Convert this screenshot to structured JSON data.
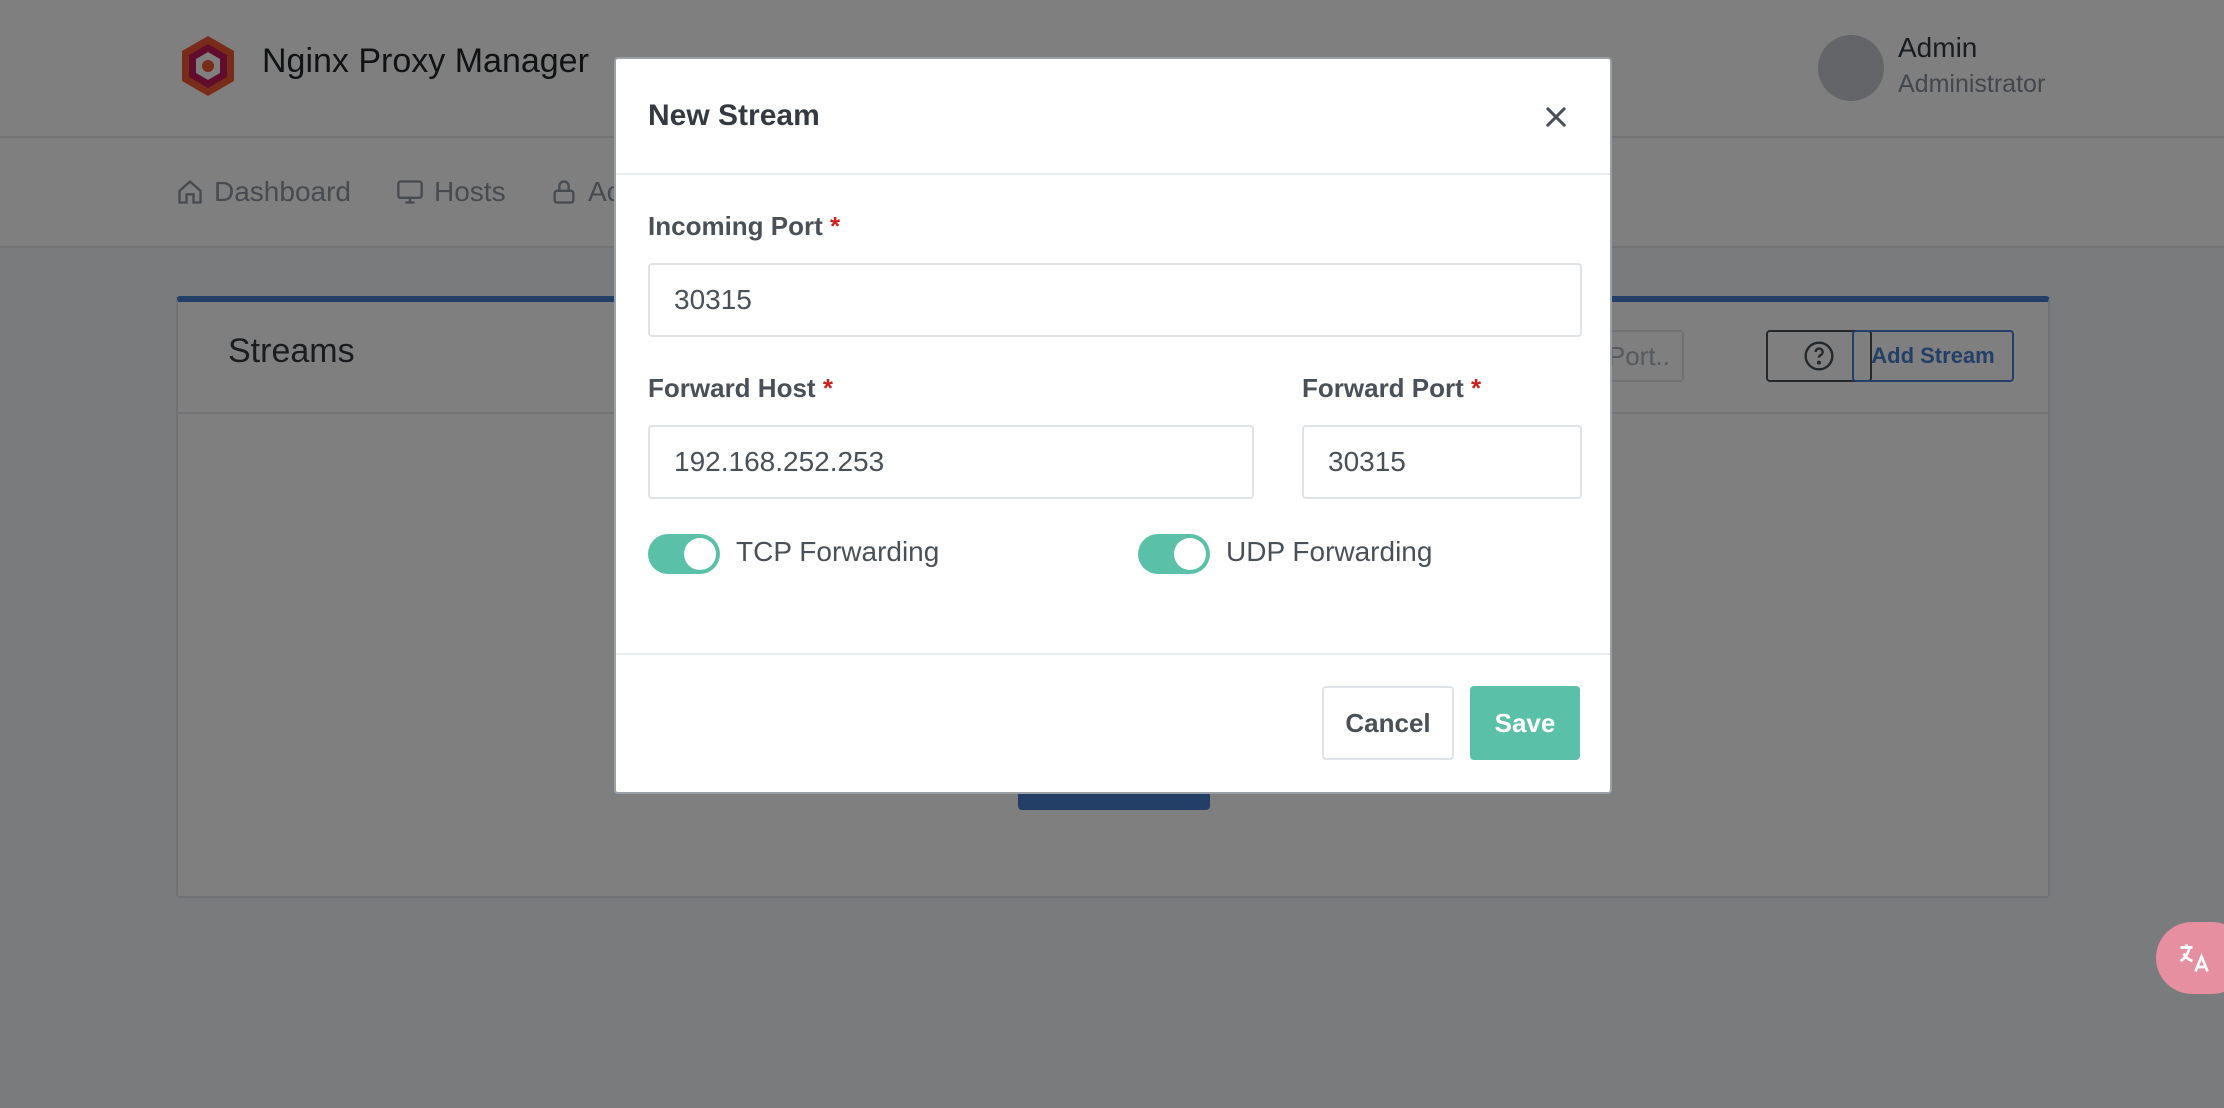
{
  "app": {
    "title": "Nginx Proxy Manager",
    "user_name": "Admin",
    "user_role": "Administrator"
  },
  "nav": {
    "items": [
      {
        "label": "Dashboard",
        "icon": "home-icon"
      },
      {
        "label": "Hosts",
        "icon": "monitor-icon"
      },
      {
        "label": "Ac",
        "icon": "lock-icon"
      }
    ]
  },
  "card": {
    "title": "Streams",
    "search_placeholder": "ning Port..",
    "add_button": "Add Stream"
  },
  "modal": {
    "title": "New Stream",
    "incoming_port_label": "Incoming Port",
    "incoming_port_value": "30315",
    "forward_host_label": "Forward Host",
    "forward_host_value": "192.168.252.253",
    "forward_port_label": "Forward Port",
    "forward_port_value": "30315",
    "required_mark": "*",
    "tcp_label": "TCP Forwarding",
    "tcp_enabled": true,
    "udp_label": "UDP Forwarding",
    "udp_enabled": true,
    "cancel_label": "Cancel",
    "save_label": "Save"
  },
  "colors": {
    "accent": "#467fcf",
    "toggle_on": "#5bc0a8",
    "save": "#5bc0a8",
    "required": "#cd201f"
  }
}
